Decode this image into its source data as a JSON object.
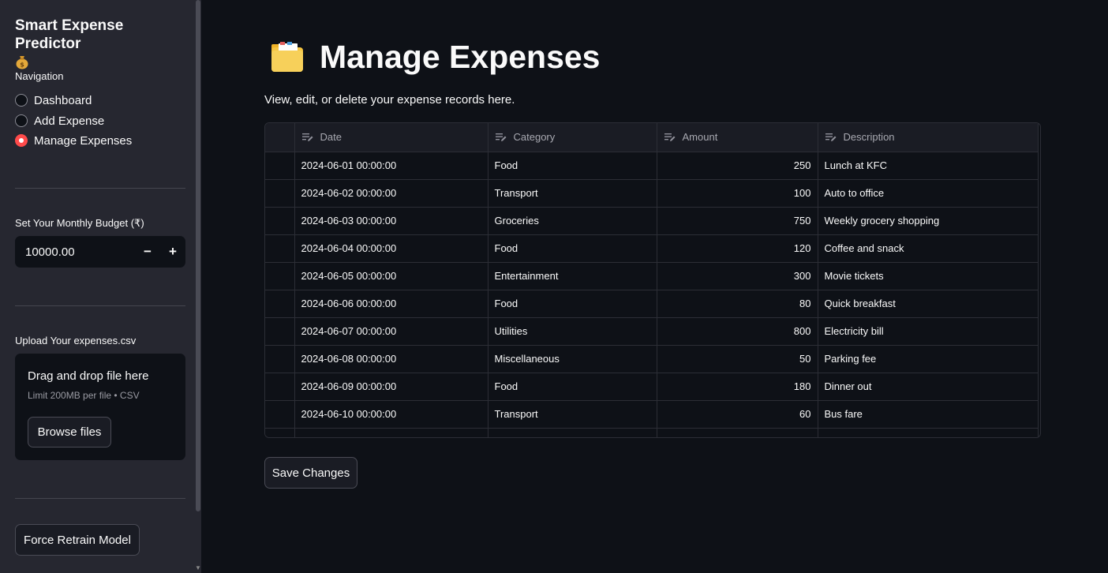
{
  "sidebar": {
    "app_title": "Smart Expense Predictor",
    "nav_label": "Navigation",
    "nav_items": [
      {
        "label": "Dashboard",
        "selected": false
      },
      {
        "label": "Add Expense",
        "selected": false
      },
      {
        "label": "Manage Expenses",
        "selected": true
      }
    ],
    "budget_label": "Set Your Monthly Budget (₹)",
    "budget_value": "10000.00",
    "budget_minus": "−",
    "budget_plus": "+",
    "upload_label": "Upload Your expenses.csv",
    "upload_drag_text": "Drag and drop file here",
    "upload_limit_text": "Limit 200MB per file • CSV",
    "browse_button": "Browse files",
    "retrain_button": "Force Retrain Model"
  },
  "main": {
    "title": "Manage Expenses",
    "subtitle": "View, edit, or delete your expense records here.",
    "save_button": "Save Changes"
  },
  "table": {
    "columns": [
      "Date",
      "Category",
      "Amount",
      "Description"
    ],
    "rows": [
      [
        "2024-06-01 00:00:00",
        "Food",
        "250",
        "Lunch at KFC"
      ],
      [
        "2024-06-02 00:00:00",
        "Transport",
        "100",
        "Auto to office"
      ],
      [
        "2024-06-03 00:00:00",
        "Groceries",
        "750",
        "Weekly grocery shopping"
      ],
      [
        "2024-06-04 00:00:00",
        "Food",
        "120",
        "Coffee and snack"
      ],
      [
        "2024-06-05 00:00:00",
        "Entertainment",
        "300",
        "Movie tickets"
      ],
      [
        "2024-06-06 00:00:00",
        "Food",
        "80",
        "Quick breakfast"
      ],
      [
        "2024-06-07 00:00:00",
        "Utilities",
        "800",
        "Electricity bill"
      ],
      [
        "2024-06-08 00:00:00",
        "Miscellaneous",
        "50",
        "Parking fee"
      ],
      [
        "2024-06-09 00:00:00",
        "Food",
        "180",
        "Dinner out"
      ],
      [
        "2024-06-10 00:00:00",
        "Transport",
        "60",
        "Bus fare"
      ]
    ]
  },
  "icons": {
    "title_icon": "file-folder-icon",
    "app_icon": "money-bag-icon",
    "column_icon": "edit-text-icon"
  },
  "colors": {
    "accent": "#ff4b4b",
    "background": "#0e1117",
    "sidebar": "#262730"
  }
}
